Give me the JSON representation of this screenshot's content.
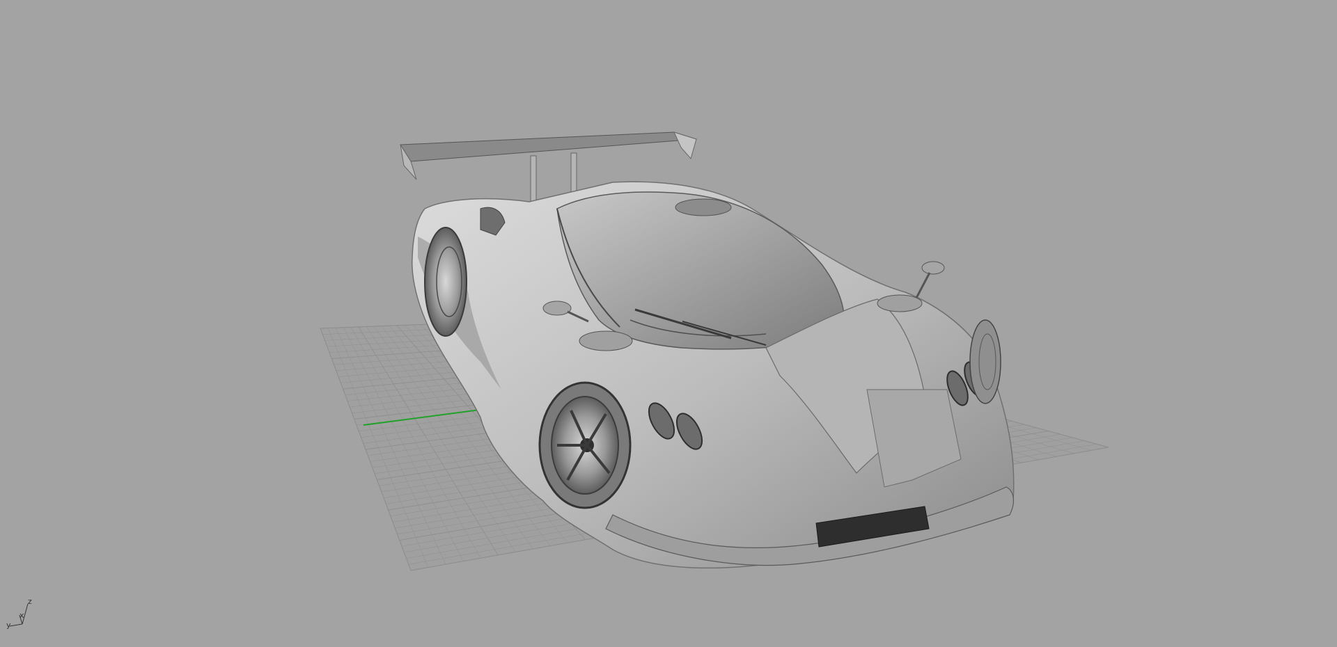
{
  "viewport": {
    "background_color": "#a3a3a3",
    "grid_line_color": "#8f8f8f",
    "grid_axis_color": "#22a12a",
    "model_shade_color": "#c4c4c4",
    "model_dark_color": "#2e2e2e"
  },
  "axis_triad": {
    "z_label": "z",
    "x_label": "x",
    "y_label": "y"
  }
}
